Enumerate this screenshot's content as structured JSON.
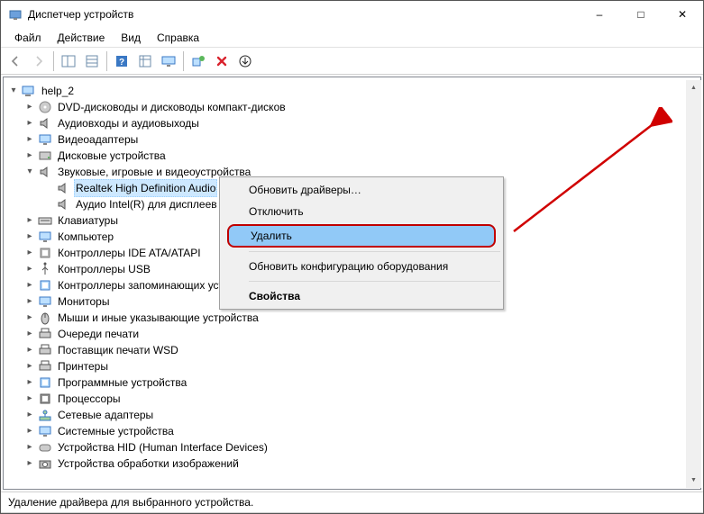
{
  "title": "Диспетчер устройств",
  "menubar": {
    "file": "Файл",
    "action": "Действие",
    "view": "Вид",
    "help": "Справка"
  },
  "root": "help_2",
  "categories": [
    {
      "key": "dvd",
      "label": "DVD-дисководы и дисководы компакт-дисков",
      "expanded": false,
      "children": []
    },
    {
      "key": "audio_io",
      "label": "Аудиовходы и аудиовыходы",
      "expanded": false,
      "children": []
    },
    {
      "key": "video",
      "label": "Видеоадаптеры",
      "expanded": false,
      "children": []
    },
    {
      "key": "disk",
      "label": "Дисковые устройства",
      "expanded": false,
      "children": []
    },
    {
      "key": "sound",
      "label": "Звуковые, игровые и видеоустройства",
      "expanded": true,
      "children": [
        {
          "key": "realtek",
          "label": "Realtek High Definition Audio",
          "selected": true
        },
        {
          "key": "intel_disp",
          "label": "Аудио Intel(R) для дисплеев"
        }
      ]
    },
    {
      "key": "keyboard",
      "label": "Клавиатуры",
      "expanded": false
    },
    {
      "key": "computer",
      "label": "Компьютер",
      "expanded": false
    },
    {
      "key": "ide",
      "label": "Контроллеры IDE ATA/ATAPI",
      "expanded": false
    },
    {
      "key": "usb",
      "label": "Контроллеры USB",
      "expanded": false
    },
    {
      "key": "storage",
      "label": "Контроллеры запоминающих устройств",
      "expanded": false
    },
    {
      "key": "monitor",
      "label": "Мониторы",
      "expanded": false
    },
    {
      "key": "mouse",
      "label": "Мыши и иные указывающие устройства",
      "expanded": false
    },
    {
      "key": "printq",
      "label": "Очереди печати",
      "expanded": false
    },
    {
      "key": "wsd",
      "label": "Поставщик печати WSD",
      "expanded": false
    },
    {
      "key": "printer",
      "label": "Принтеры",
      "expanded": false
    },
    {
      "key": "software",
      "label": "Программные устройства",
      "expanded": false
    },
    {
      "key": "cpu",
      "label": "Процессоры",
      "expanded": false
    },
    {
      "key": "net",
      "label": "Сетевые адаптеры",
      "expanded": false
    },
    {
      "key": "system",
      "label": "Системные устройства",
      "expanded": false
    },
    {
      "key": "hid",
      "label": "Устройства HID (Human Interface Devices)",
      "expanded": false
    },
    {
      "key": "imaging",
      "label": "Устройства обработки изображений",
      "expanded": false
    }
  ],
  "context_menu": {
    "update": "Обновить драйверы…",
    "disable": "Отключить",
    "uninstall": "Удалить",
    "scan": "Обновить конфигурацию оборудования",
    "properties": "Свойства"
  },
  "statusbar": "Удаление драйвера для выбранного устройства.",
  "icons": {
    "computer": "💻",
    "disc": "💿",
    "speaker": "🔊",
    "display": "🖥",
    "disk": "📀",
    "keyboard": "⌨",
    "pc": "🖥",
    "controller": "🔌",
    "usb": "🔌",
    "storage": "🗄",
    "monitor": "🖥",
    "mouse": "🖱",
    "printer": "🖨",
    "wsd": "🖨",
    "soft": "⚙",
    "cpu": "▣",
    "net": "🖧",
    "cog": "⚙",
    "hid": "🎮",
    "camera": "📷"
  }
}
